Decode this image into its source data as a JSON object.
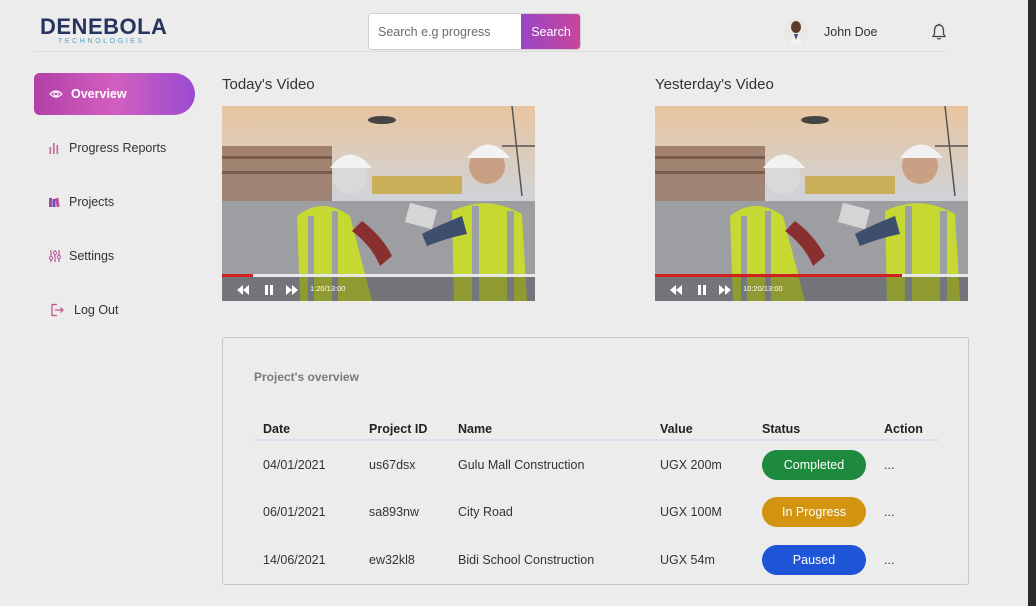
{
  "header": {
    "logo_text": "DENEBOLA",
    "logo_sub": "TECHNOLOGIES",
    "search_placeholder": "Search e.g progress",
    "search_button": "Search",
    "user_name": "John Doe",
    "avatar_icon": "user-avatar",
    "bell_icon": "bell-icon"
  },
  "sidebar": {
    "items": [
      {
        "label": "Overview",
        "icon": "eye-icon",
        "active": true
      },
      {
        "label": "Progress Reports",
        "icon": "bar-chart-icon"
      },
      {
        "label": "Projects",
        "icon": "books-icon"
      },
      {
        "label": "Settings",
        "icon": "sliders-icon"
      },
      {
        "label": "Log Out",
        "icon": "logout-icon"
      }
    ]
  },
  "videos": [
    {
      "title": "Today's Video",
      "time": "1:20/13:00",
      "progress": 0.1
    },
    {
      "title": "Yesterday's Video",
      "time": "10:20/13:00",
      "progress": 0.79
    }
  ],
  "overview": {
    "title": "Project's overview",
    "columns": [
      "Date",
      "Project ID",
      "Name",
      "Value",
      "Status",
      "Action"
    ],
    "rows": [
      {
        "date": "04/01/2021",
        "id": "us67dsx",
        "name": "Gulu Mall Construction",
        "value": "UGX 200m",
        "status": "Completed",
        "status_color": "#1e8a3e",
        "action": "..."
      },
      {
        "date": "06/01/2021",
        "id": "sa893nw",
        "name": "City Road",
        "value": "UGX 100M",
        "status": "In Progress",
        "status_color": "#d3950f",
        "action": "..."
      },
      {
        "date": "14/06/2021",
        "id": "ew32kl8",
        "name": "Bidi School Construction",
        "value": "UGX 54m",
        "status": "Paused",
        "status_color": "#1e55d6",
        "action": "..."
      }
    ]
  },
  "colors": {
    "accent_gradient_start": "#9b45c6",
    "accent_gradient_end": "#c7479a",
    "logo": "#27345f",
    "logo_sub": "#4fa6c7"
  }
}
